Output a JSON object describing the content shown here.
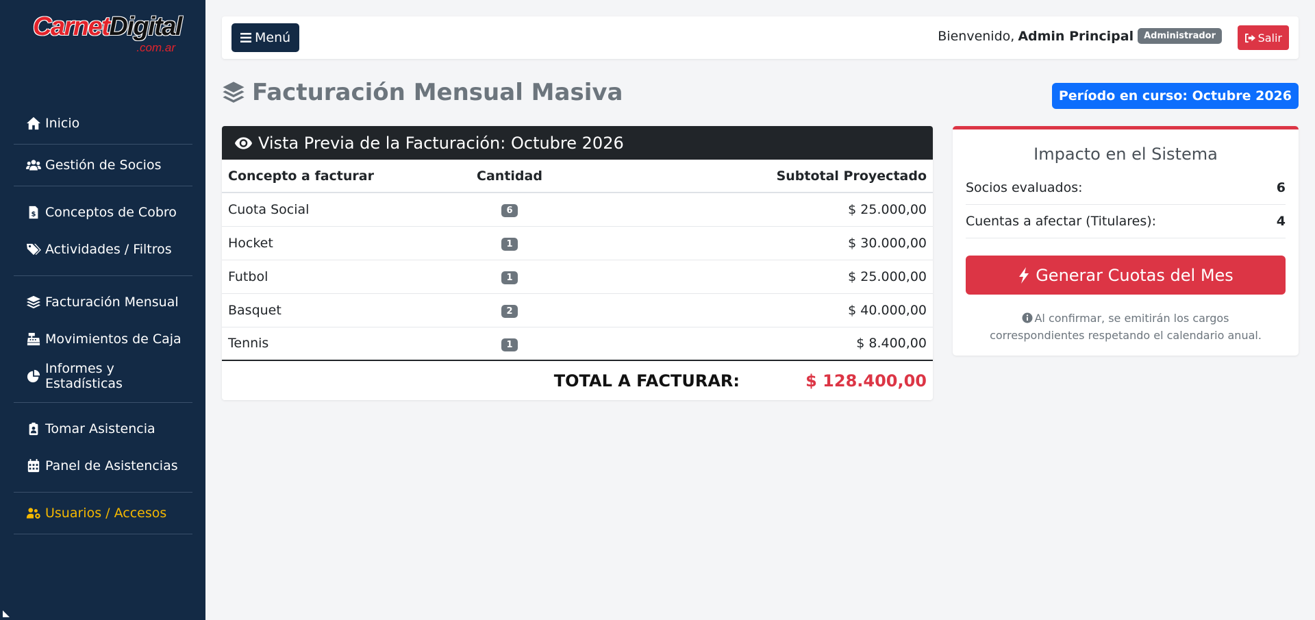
{
  "logo": {
    "brand_part1": "Carnet",
    "brand_part2": "Digital",
    "suffix": ".com.ar"
  },
  "sidebar": {
    "groups": [
      {
        "items": [
          {
            "label": "Inicio",
            "icon": "home-icon"
          }
        ]
      },
      {
        "items": [
          {
            "label": "Gestión de Socios",
            "icon": "users-icon"
          }
        ]
      },
      {
        "items": [
          {
            "label": "Conceptos de Cobro",
            "icon": "invoice-dollar-icon"
          },
          {
            "label": "Actividades / Filtros",
            "icon": "tags-icon"
          }
        ]
      },
      {
        "items": [
          {
            "label": "Facturación Mensual",
            "icon": "layers-icon"
          },
          {
            "label": "Movimientos de Caja",
            "icon": "cash-register-icon"
          },
          {
            "label": "Informes y Estadísticas",
            "icon": "pie-chart-icon"
          }
        ]
      },
      {
        "items": [
          {
            "label": "Tomar Asistencia",
            "icon": "clipboard-user-icon"
          },
          {
            "label": "Panel de Asistencias",
            "icon": "calendar-icon"
          }
        ]
      },
      {
        "items": [
          {
            "label": "Usuarios / Accesos",
            "icon": "users-gear-icon",
            "active": true
          }
        ]
      }
    ],
    "active_color": "#f5b800",
    "background": "#132a45"
  },
  "topbar": {
    "menu_label": "Menú",
    "welcome_prefix": "Bienvenido,",
    "user_name": "Admin Principal",
    "role": "Administrador",
    "logout_label": "Salir"
  },
  "page": {
    "title": "Facturación Mensual Masiva",
    "period_badge": "Período en curso: Octubre 2026"
  },
  "preview": {
    "header": "Vista Previa de la Facturación: Octubre 2026",
    "columns": [
      "Concepto a facturar",
      "Cantidad",
      "Subtotal Proyectado"
    ],
    "rows": [
      {
        "concept": "Cuota Social",
        "qty": "6",
        "subtotal": "$ 25.000,00"
      },
      {
        "concept": "Hocket",
        "qty": "1",
        "subtotal": "$ 30.000,00"
      },
      {
        "concept": "Futbol",
        "qty": "1",
        "subtotal": "$ 25.000,00"
      },
      {
        "concept": "Basquet",
        "qty": "2",
        "subtotal": "$ 40.000,00"
      },
      {
        "concept": "Tennis",
        "qty": "1",
        "subtotal": "$ 8.400,00"
      }
    ],
    "total_label": "TOTAL A FACTURAR:",
    "total_value": "$ 128.400,00"
  },
  "impact": {
    "title": "Impacto en el Sistema",
    "socios_label": "Socios evaluados:",
    "socios_value": "6",
    "cuentas_label": "Cuentas a afectar (Titulares):",
    "cuentas_value": "4",
    "button_label": "Generar Cuotas del Mes",
    "note": "Al confirmar, se emitirán los cargos correspondientes respetando el calendario anual."
  },
  "colors": {
    "danger": "#dc3545",
    "primary": "#0d6efd",
    "dark": "#212529"
  }
}
